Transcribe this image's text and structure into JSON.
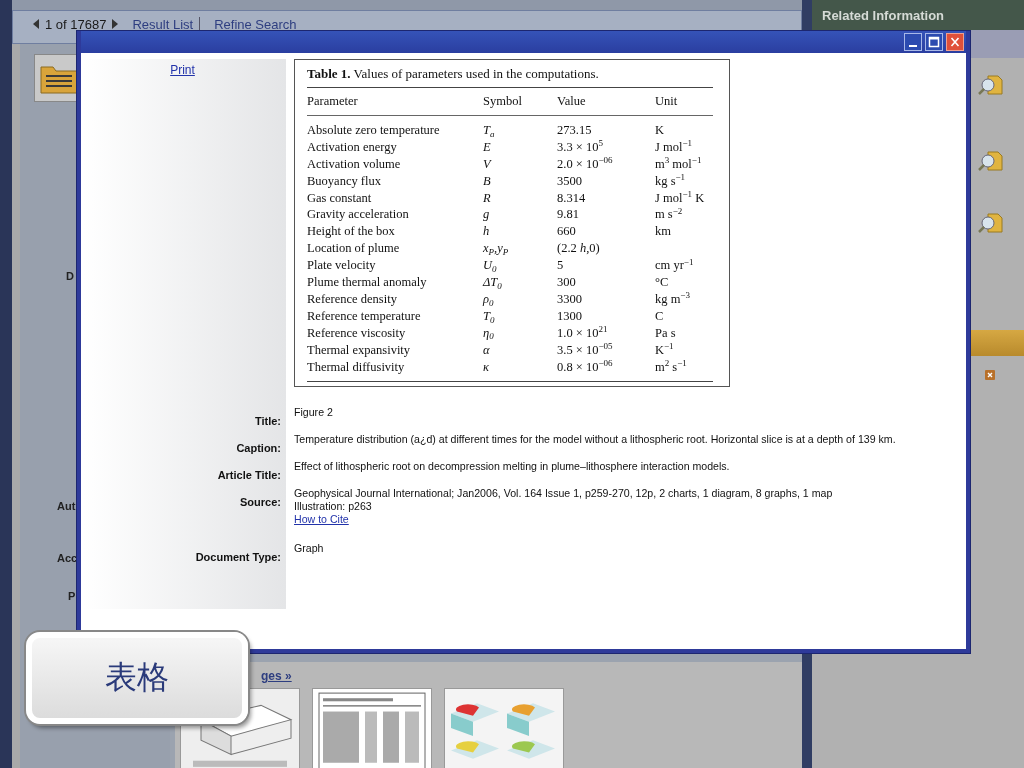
{
  "background_page": {
    "nav": {
      "position": "1 of 17687",
      "links": [
        "Result List",
        "Refine Search"
      ]
    },
    "field_labels": [
      "D",
      "Aut",
      "Acc",
      "P"
    ],
    "images_link": "ges »"
  },
  "related_information": {
    "title": "Related Information"
  },
  "dialog": {
    "print_link": "Print",
    "table": {
      "caption": "**Table 1.**  Values of parameters used in the computations.",
      "columns": [
        "Parameter",
        "Symbol",
        "Value",
        "Unit"
      ],
      "rows": [
        [
          "Absolute zero temperature",
          "T$_{a}$",
          "273.15",
          "K"
        ],
        [
          "Activation energy",
          "E",
          "3.3 × 10$^{5}$",
          "J mol$^{−1}$"
        ],
        [
          "Activation volume",
          "V",
          "2.0 × 10$^{−06}$",
          "m$^{3}$ mol$^{−1}$"
        ],
        [
          "Buoyancy flux",
          "B",
          "3500",
          "kg s$^{−1}$"
        ],
        [
          "Gas constant",
          "R",
          "8.314",
          "J mol$^{−1}$ K"
        ],
        [
          "Gravity acceleration",
          "g",
          "9.81",
          "m s$^{−2}$"
        ],
        [
          "Height of the box",
          "h",
          "660",
          "km"
        ],
        [
          "Location of plume",
          "x$_{P}$,y$_{P}$",
          "(2.2 *h*,0)",
          ""
        ],
        [
          "Plate velocity",
          "U$_{0}$",
          "5",
          "cm yr$^{−1}$"
        ],
        [
          "Plume thermal anomaly",
          "ΔT$_{0}$",
          "300",
          "°C"
        ],
        [
          "Reference density",
          "ρ$_{0}$",
          "3300",
          "kg m$^{−3}$"
        ],
        [
          "Reference temperature",
          "T$_{0}$",
          "1300",
          "C"
        ],
        [
          "Reference viscosity",
          "η$_{0}$",
          "1.0 × 10$^{21}$",
          "Pa s"
        ],
        [
          "Thermal expansivity",
          "α",
          "3.5 × 10$^{−05}$",
          "K$^{−1}$"
        ],
        [
          "Thermal diffusivity",
          "κ",
          "0.8 × 10$^{−06}$",
          "m$^{2}$ s$^{−1}$"
        ]
      ]
    },
    "fields": [
      {
        "label": "Title:",
        "lines": [
          {
            "kind": "text",
            "text": "Figure 2"
          }
        ]
      },
      {
        "label": "Caption:",
        "lines": [
          {
            "kind": "text",
            "text": "Temperature distribution (a¿d) at different times for the model without a lithospheric root. Horizontal slice is at a depth of 139 km."
          }
        ]
      },
      {
        "label": "Article Title:",
        "lines": [
          {
            "kind": "text",
            "text": "Effect of lithospheric root on decompression melting in plume–lithosphere interaction models."
          }
        ]
      },
      {
        "label": "Source:",
        "lines": [
          {
            "kind": "text",
            "text": "Geophysical Journal International; Jan2006, Vol. 164 Issue 1, p259-270, 12p, 2 charts, 1 diagram, 8 graphs, 1 map"
          },
          {
            "kind": "text",
            "text": "Illustration: p263"
          },
          {
            "kind": "link",
            "text": "How to Cite"
          }
        ]
      },
      {
        "label": "Document Type:",
        "lines": [
          {
            "kind": "text",
            "text": "Graph"
          }
        ]
      }
    ]
  },
  "badge": "表格"
}
